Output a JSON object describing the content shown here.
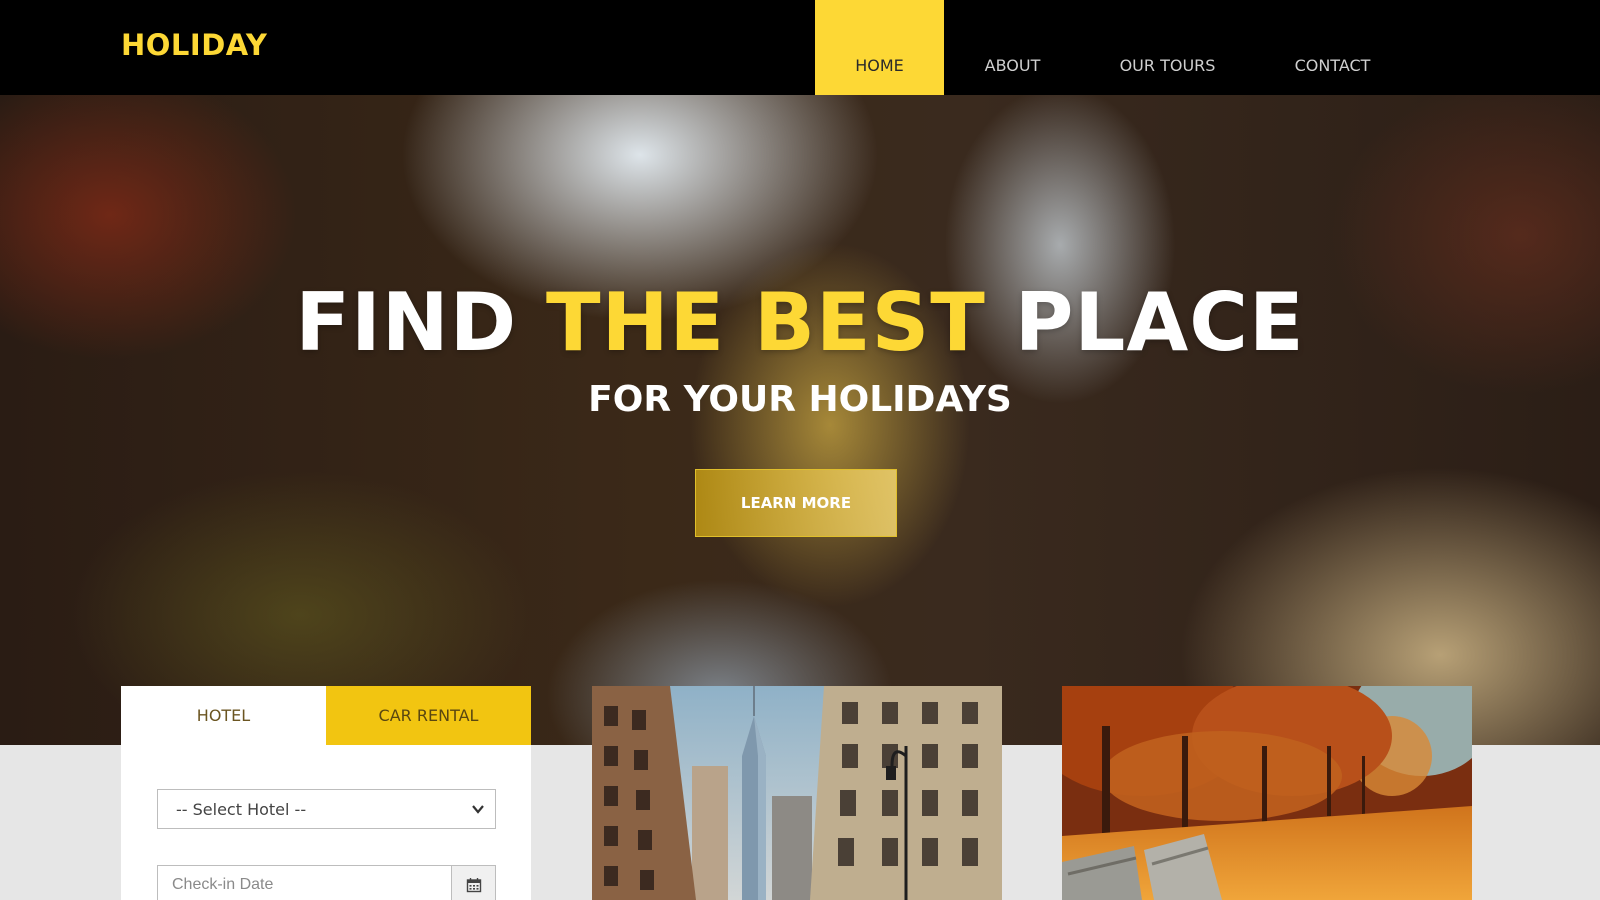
{
  "brand": {
    "name": "HOLIDAY"
  },
  "nav": {
    "home": "HOME",
    "about": "ABOUT",
    "tours": "OUR TOURS",
    "contact": "CONTACT",
    "active": "HOME"
  },
  "hero": {
    "title_part1": "FIND ",
    "title_accent": "THE BEST",
    "title_part2": " PLACE",
    "subtitle": "FOR YOUR HOLIDAYS",
    "button": "LEARN MORE"
  },
  "booking": {
    "tabs": {
      "hotel": "HOTEL",
      "car": "CAR RENTAL"
    },
    "active_tab": "HOTEL",
    "hotel_select_value": "-- Select Hotel --",
    "checkin_placeholder": "Check-in Date"
  },
  "cards": [
    {
      "subject": "city skyline between historic buildings"
    },
    {
      "subject": "autumn park with benches"
    }
  ],
  "icons": {
    "chevron": "chevron-down-icon",
    "calendar": "calendar-icon"
  },
  "colors": {
    "accent": "#fdd835",
    "tab_inactive": "#f2c511",
    "nav_bg": "#000000",
    "page_bg": "#e6e6e6"
  }
}
